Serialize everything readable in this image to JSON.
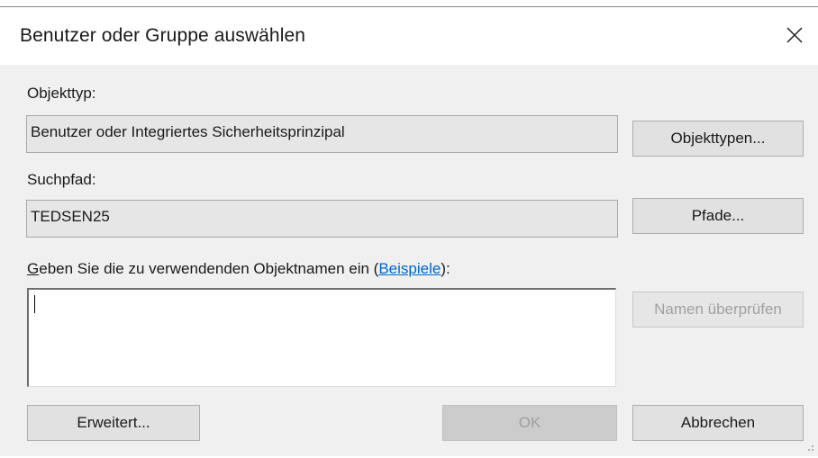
{
  "dialog": {
    "title": "Benutzer oder Gruppe auswählen",
    "close_icon": "close-icon"
  },
  "object_type": {
    "label": "Objekttyp:",
    "value": "Benutzer oder Integriertes Sicherheitsprinzipal",
    "button_label": "Objekttypen..."
  },
  "search_path": {
    "label": "Suchpfad:",
    "value": "TEDSEN25",
    "button_label": "Pfade..."
  },
  "names": {
    "prompt_accel": "G",
    "prompt_rest": "eben Sie die zu verwendenden Objektnamen ein (",
    "examples_link": "Beispiele",
    "prompt_end": "):",
    "input_value": "",
    "check_button_label": "Namen überprüfen"
  },
  "footer": {
    "advanced_label": "Erweitert...",
    "ok_label": "OK",
    "cancel_label": "Abbrechen"
  }
}
